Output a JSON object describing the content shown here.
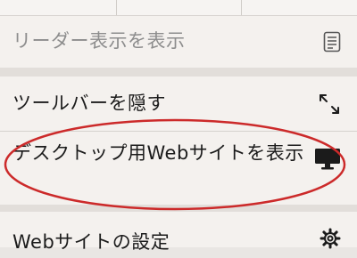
{
  "menu": {
    "items": [
      {
        "label": "リーダー表示を表示",
        "icon": "reader-view-icon",
        "enabled": false
      },
      {
        "label": "ツールバーを隠す",
        "icon": "expand-arrows-icon",
        "enabled": true
      },
      {
        "label": "デスクトップ用Webサイトを表示",
        "icon": "desktop-monitor-icon",
        "enabled": true
      },
      {
        "label": "Webサイトの設定",
        "icon": "gear-icon",
        "enabled": true
      }
    ]
  },
  "annotation": {
    "color": "#cc2a2a",
    "shape": "red-oval"
  }
}
